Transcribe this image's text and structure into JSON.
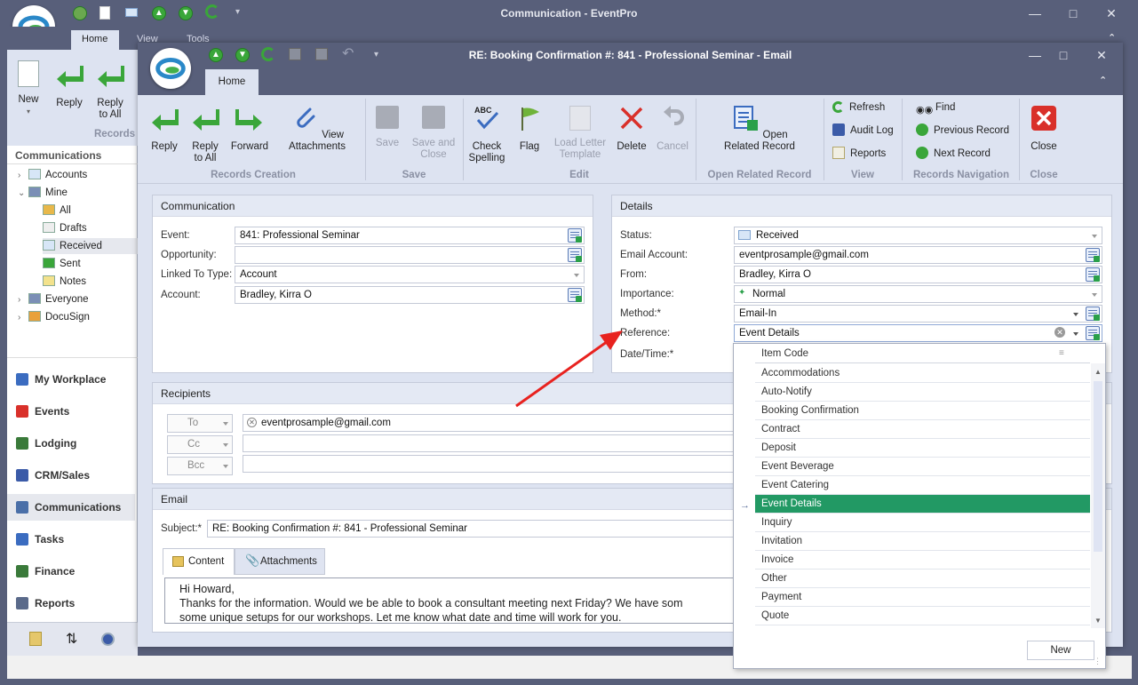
{
  "back_window": {
    "title": "Communication - EventPro",
    "tabs": [
      "Home",
      "View",
      "Tools"
    ],
    "ribbon": {
      "buttons": [
        {
          "label": "New",
          "icon": "new-document-icon"
        },
        {
          "label": "Reply",
          "icon": "reply-arrow-icon"
        },
        {
          "label": "Reply to All",
          "icon": "reply-all-arrow-icon"
        }
      ],
      "group_label": "Records"
    },
    "sidebar": {
      "header": "Communications",
      "tree": [
        {
          "label": "Accounts",
          "icon": "envelope-icon",
          "level": 1,
          "expand": "›"
        },
        {
          "label": "Mine",
          "icon": "person-icon",
          "level": 1,
          "expand": "⌄"
        },
        {
          "label": "All",
          "icon": "folder-icon",
          "level": 2
        },
        {
          "label": "Drafts",
          "icon": "draft-envelope-icon",
          "level": 2
        },
        {
          "label": "Received",
          "icon": "received-envelope-icon",
          "level": 2
        },
        {
          "label": "Sent",
          "icon": "sent-envelope-icon",
          "level": 2
        },
        {
          "label": "Notes",
          "icon": "note-icon",
          "level": 2
        },
        {
          "label": "Everyone",
          "icon": "group-icon",
          "level": 1,
          "expand": "›"
        },
        {
          "label": "DocuSign",
          "icon": "docusign-icon",
          "level": 1,
          "expand": "›"
        }
      ],
      "modules": [
        {
          "label": "My Workplace",
          "icon": "home-icon"
        },
        {
          "label": "Events",
          "icon": "pin-icon"
        },
        {
          "label": "Lodging",
          "icon": "lodging-icon"
        },
        {
          "label": "CRM/Sales",
          "icon": "crm-icon"
        },
        {
          "label": "Communications",
          "icon": "chat-icon"
        },
        {
          "label": "Tasks",
          "icon": "tasks-icon"
        },
        {
          "label": "Finance",
          "icon": "finance-icon"
        },
        {
          "label": "Reports",
          "icon": "reports-icon"
        }
      ]
    }
  },
  "front_window": {
    "title": "RE: Booking Confirmation #: 841 - Professional Seminar - Email",
    "tab": "Home",
    "ribbon": {
      "records_creation": {
        "label": "Records Creation",
        "buttons": [
          {
            "label": "Reply",
            "icon": "reply-arrow-icon"
          },
          {
            "label": "Reply to All",
            "icon": "reply-all-arrow-icon"
          },
          {
            "label": "Forward",
            "icon": "forward-arrow-icon"
          },
          {
            "label": "View Attachments",
            "icon": "paperclip-icon"
          }
        ]
      },
      "save": {
        "label": "Save",
        "buttons": [
          {
            "label": "Save",
            "icon": "save-disk-icon"
          },
          {
            "label": "Save and Close",
            "icon": "save-close-icon"
          }
        ]
      },
      "edit": {
        "label": "Edit",
        "buttons": [
          {
            "label": "Check Spelling",
            "icon": "spell-check-icon"
          },
          {
            "label": "Flag",
            "icon": "flag-icon"
          },
          {
            "label": "Load Letter Template",
            "icon": "template-icon"
          },
          {
            "label": "Delete",
            "icon": "delete-x-icon"
          },
          {
            "label": "Cancel",
            "icon": "undo-icon"
          }
        ]
      },
      "open_related": {
        "label": "Open Related Record",
        "button": {
          "label": "Open Related Record",
          "icon": "related-record-icon"
        }
      },
      "view": {
        "label": "View",
        "buttons": [
          {
            "label": "Refresh",
            "icon": "refresh-icon"
          },
          {
            "label": "Audit Log",
            "icon": "audit-log-icon"
          },
          {
            "label": "Reports",
            "icon": "reports-icon"
          }
        ]
      },
      "navigation": {
        "label": "Records Navigation",
        "buttons": [
          {
            "label": "Find",
            "icon": "binoculars-icon"
          },
          {
            "label": "Previous Record",
            "icon": "previous-icon"
          },
          {
            "label": "Next Record",
            "icon": "next-icon"
          }
        ]
      },
      "close": {
        "label": "Close",
        "button": {
          "label": "Close",
          "icon": "close-red-icon"
        }
      }
    },
    "communication_panel": {
      "header": "Communication",
      "fields": [
        {
          "label": "Event:",
          "value": "841: Professional Seminar"
        },
        {
          "label": "Opportunity:",
          "value": ""
        },
        {
          "label": "Linked To Type:",
          "value": "Account"
        },
        {
          "label": "Account:",
          "value": "Bradley, Kirra O"
        }
      ]
    },
    "details_panel": {
      "header": "Details",
      "fields": [
        {
          "label": "Status:",
          "value": "Received"
        },
        {
          "label": "Email Account:",
          "value": "eventprosample@gmail.com"
        },
        {
          "label": "From:",
          "value": "Bradley, Kirra O"
        },
        {
          "label": "Importance:",
          "value": "Normal"
        },
        {
          "label": "Method:*",
          "value": "Email-In"
        },
        {
          "label": "Reference:",
          "value": "Event Details"
        },
        {
          "label": "Date/Time:*",
          "value": ""
        }
      ]
    },
    "recipients_panel": {
      "header": "Recipients",
      "rows": [
        {
          "type": "To",
          "value": "eventprosample@gmail.com"
        },
        {
          "type": "Cc",
          "value": ""
        },
        {
          "type": "Bcc",
          "value": ""
        }
      ]
    },
    "email_panel": {
      "header": "Email",
      "subject_label": "Subject:*",
      "subject": "RE: Booking Confirmation #: 841 - Professional Seminar",
      "tabs": [
        "Content",
        "Attachments"
      ],
      "body_lines": [
        "Hi Howard,",
        "Thanks for the information.  Would we be able to book a consultant meeting next Friday?  We have som",
        "some unique setups for our workshops.  Let me know what date and time will work for you."
      ]
    },
    "reference_dropdown": {
      "column_header": "Item Code",
      "items": [
        "Accommodations",
        "Auto-Notify",
        "Booking Confirmation",
        "Contract",
        "Deposit",
        "Event Beverage",
        "Event Catering",
        "Event Details",
        "Inquiry",
        "Invitation",
        "Invoice",
        "Other",
        "Payment",
        "Quote"
      ],
      "selected": "Event Details",
      "new_button": "New"
    }
  },
  "colors": {
    "title_bar": "#585f7a",
    "ribbon_bg": "#dde3f1",
    "selection_green": "#229964",
    "annotation_arrow": "#e8221f"
  }
}
